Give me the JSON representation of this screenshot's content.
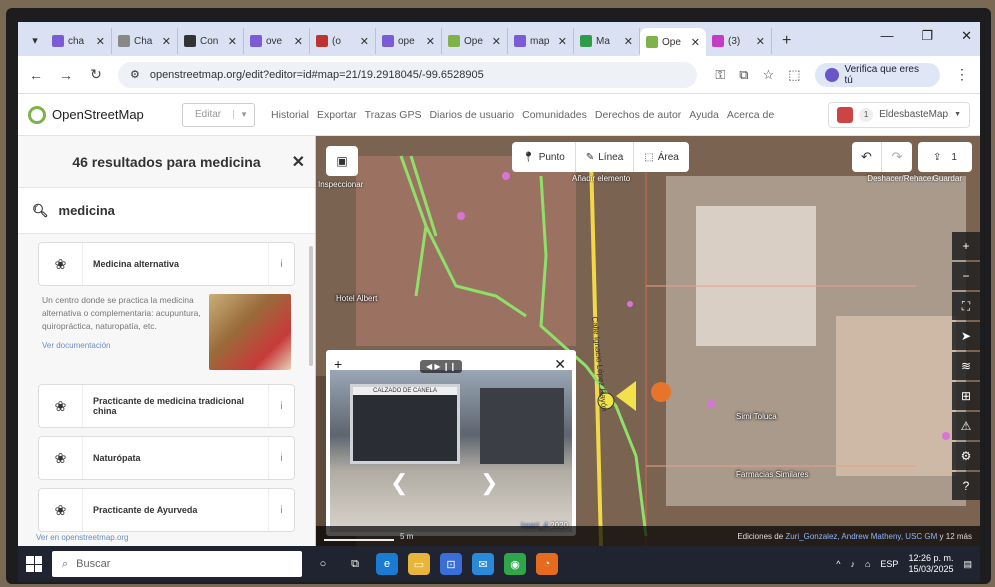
{
  "browser": {
    "tabs": [
      {
        "label": "cha",
        "color": "#7b5cd6"
      },
      {
        "label": "Cha",
        "color": "#888888"
      },
      {
        "label": "Con",
        "color": "#333333"
      },
      {
        "label": "ove",
        "color": "#7b5cd6"
      },
      {
        "label": "(o",
        "color": "#b33"
      },
      {
        "label": "ope",
        "color": "#7b5cd6"
      },
      {
        "label": "Ope",
        "color": "#7fb24a"
      },
      {
        "label": "map",
        "color": "#7b5cd6"
      },
      {
        "label": "Ma",
        "color": "#2e9d4a"
      },
      {
        "label": "Ope",
        "color": "#7fb24a",
        "active": true
      },
      {
        "label": "(3)",
        "color": "#c63bc6"
      }
    ],
    "url": "openstreetmap.org/edit?editor=id#map=21/19.2918045/-99.6528905",
    "verify_label": "Verifica que eres tú"
  },
  "osm": {
    "brand": "OpenStreetMap",
    "edit_label": "Editar",
    "nav": [
      "Historial",
      "Exportar",
      "Trazas GPS",
      "Diarios de usuario",
      "Comunidades",
      "Derechos de autor",
      "Ayuda",
      "Acerca de"
    ],
    "user": "EldesbasteMap",
    "user_badge": "1"
  },
  "sidebar": {
    "title": "46 resultados para medicina",
    "search_value": "medicina",
    "presets": [
      {
        "label": "Medicina alternativa"
      },
      {
        "label": "Practicante de medicina tradicional china"
      },
      {
        "label": "Naturópata"
      },
      {
        "label": "Practicante de Ayurveda"
      }
    ],
    "reference_text": "Un centro donde se practica la medicina alternativa o complementaria: acupuntura, quiropráctica, naturopatía, etc.",
    "doc_link": "Ver documentación",
    "footer_link": "Ver en openstreetmap.org"
  },
  "map": {
    "modes": {
      "point": "Punto",
      "line": "Línea",
      "area": "Área"
    },
    "add_label": "Añadir elemento",
    "inspect_label": "Inspeccionar",
    "undo_label": "Deshacer/Rehacer",
    "save_label": "Guardar",
    "save_count": "1",
    "poi": {
      "hotel": "Hotel Albert",
      "simi": "Simi Toluca",
      "farmacia": "Farmacias Similares"
    },
    "street": "Calle Ignacio López Rayón",
    "viewer": {
      "sign": "CALZADO DE CANELA",
      "caption_user": "kaart_4",
      "caption_year": "2020"
    },
    "scale": "5 m",
    "attribution_prefix": "Ediciones de",
    "attribution_users": "Zuri_Gonzalez, Andrew Matheny, USC GM",
    "attribution_more": "y 12 más"
  },
  "taskbar": {
    "search_placeholder": "Buscar",
    "lang": "ESP",
    "time": "12:26 p. m.",
    "date": "15/03/2025"
  }
}
